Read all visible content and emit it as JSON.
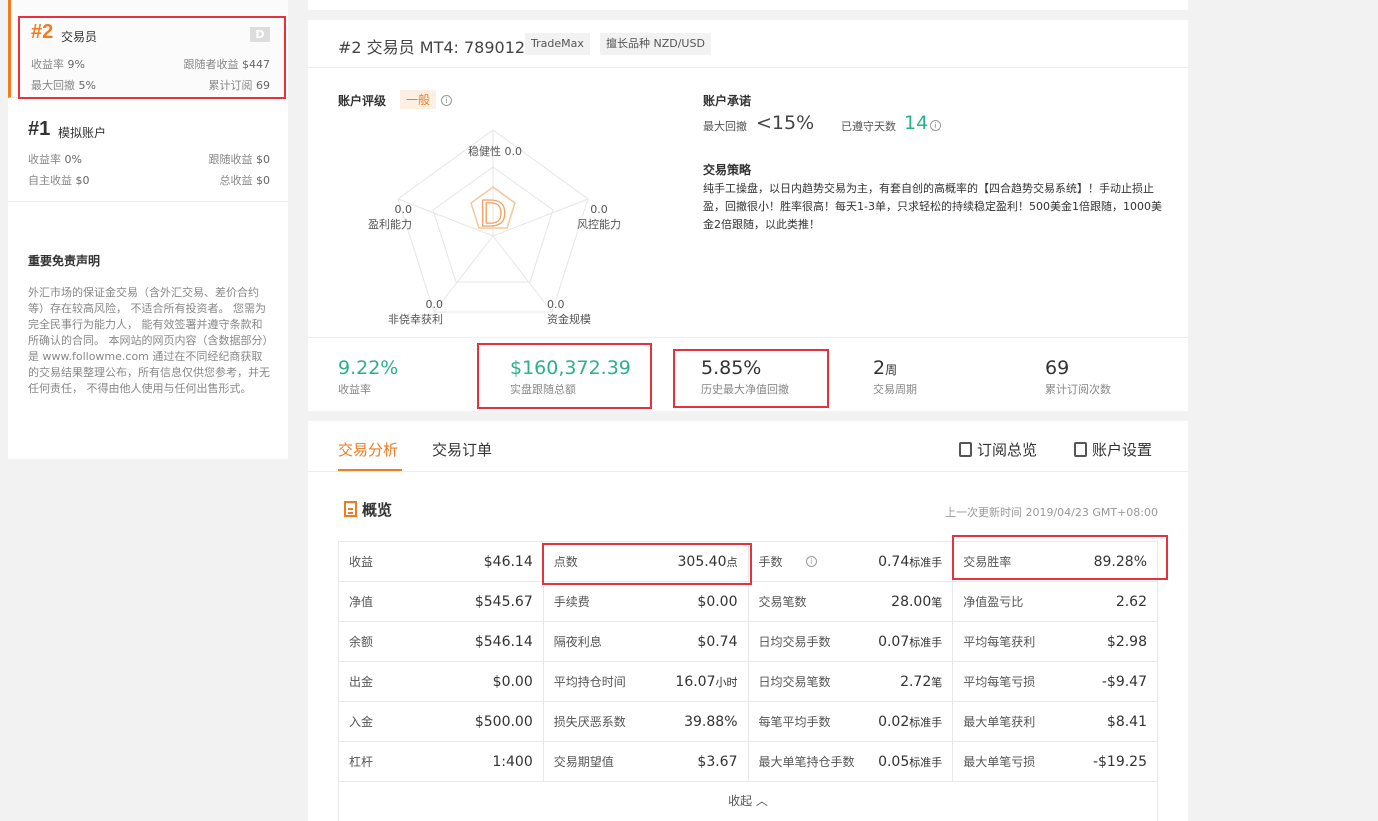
{
  "sidebar": {
    "accounts": [
      {
        "rank": "#2",
        "name": "交易员",
        "badge": "D",
        "row1_left_label": "收益率",
        "row1_left_value": "9%",
        "row1_right_label": "跟随者收益",
        "row1_right_value": "$447",
        "row2_left_label": "最大回撤",
        "row2_left_value": "5%",
        "row2_right_label": "累计订阅",
        "row2_right_value": "69"
      },
      {
        "rank": "#1",
        "name": "模拟账户",
        "row1_left_label": "收益率",
        "row1_left_value": "0%",
        "row1_right_label": "跟随收益",
        "row1_right_value": "$0",
        "row2_left_label": "自主收益",
        "row2_left_value": "$0",
        "row2_right_label": "总收益",
        "row2_right_value": "$0"
      }
    ],
    "disclaimer_title": "重要免责声明",
    "disclaimer_text": "外汇市场的保证金交易（含外汇交易、差价合约等）存在较高风险， 不适合所有投资者。 您需为完全民事行为能力人， 能有效签署并遵守条款和所确认的合同。 本网站的网页内容（含数据部分）是 www.followme.com 通过在不同经纪商获取的交易结果整理公布，所有信息仅供您参考，并无任何责任， 不得由他人使用与任何出售形式。"
  },
  "header": {
    "title": "#2 交易员  MT4: 789012",
    "broker": "TradeMax",
    "specialty": "擅长品种 NZD/USD"
  },
  "rating": {
    "label": "账户评级",
    "level": "一般",
    "grade": "D",
    "axes": [
      {
        "name": "稳健性",
        "value": "0.0"
      },
      {
        "name": "风控能力",
        "value": "0.0"
      },
      {
        "name": "资金规模",
        "value": "0.0"
      },
      {
        "name": "非侥幸获利",
        "value": "0.0"
      },
      {
        "name": "盈利能力",
        "value": "0.0"
      }
    ]
  },
  "promise": {
    "title": "账户承诺",
    "drawdown_label": "最大回撤",
    "drawdown_value": "<15%",
    "days_label": "已遵守天数",
    "days_value": "14"
  },
  "strategy": {
    "title": "交易策略",
    "text": "纯手工操盘，以日内趋势交易为主，有套自创的高概率的【四合趋势交易系统】！手动止损止盈，回撤很小！胜率很高！每天1-3单，只求轻松的持续稳定盈利！500美金1倍跟随，1000美金2倍跟随，以此类推！"
  },
  "stats": [
    {
      "value": "9.22%",
      "label": "收益率"
    },
    {
      "value": "$160,372.39",
      "label": "实盘跟随总额"
    },
    {
      "value": "5.85%",
      "label": "历史最大净值回撤"
    },
    {
      "value": "2",
      "unit": "周",
      "label": "交易周期"
    },
    {
      "value": "69",
      "label": "累计订阅次数"
    }
  ],
  "tabs": {
    "analysis": "交易分析",
    "orders": "交易订单",
    "subscribe_overview": "订阅总览",
    "account_settings": "账户设置"
  },
  "overview": {
    "title": "概览",
    "updated": "上一次更新时间 2019/04/23 GMT+08:00",
    "rows": [
      [
        [
          "收益",
          "$46.14",
          ""
        ],
        [
          "点数",
          "305.40",
          "点"
        ],
        [
          "手数",
          "0.74",
          "标准手"
        ],
        [
          "交易胜率",
          "89.28%",
          ""
        ]
      ],
      [
        [
          "净值",
          "$545.67",
          ""
        ],
        [
          "手续费",
          "$0.00",
          ""
        ],
        [
          "交易笔数",
          "28.00",
          "笔"
        ],
        [
          "净值盈亏比",
          "2.62",
          ""
        ]
      ],
      [
        [
          "余额",
          "$546.14",
          ""
        ],
        [
          "隔夜利息",
          "$0.74",
          ""
        ],
        [
          "日均交易手数",
          "0.07",
          "标准手"
        ],
        [
          "平均每笔获利",
          "$2.98",
          ""
        ]
      ],
      [
        [
          "出金",
          "$0.00",
          ""
        ],
        [
          "平均持仓时间",
          "16.07",
          "小时"
        ],
        [
          "日均交易笔数",
          "2.72",
          "笔"
        ],
        [
          "平均每笔亏损",
          "-$9.47",
          ""
        ]
      ],
      [
        [
          "入金",
          "$500.00",
          ""
        ],
        [
          "损失厌恶系数",
          "39.88%",
          ""
        ],
        [
          "每笔平均手数",
          "0.02",
          "标准手"
        ],
        [
          "最大单笔获利",
          "$8.41",
          ""
        ]
      ],
      [
        [
          "杠杆",
          "1:400",
          ""
        ],
        [
          "交易期望值",
          "$3.67",
          ""
        ],
        [
          "最大单笔持仓手数",
          "0.05",
          "标准手"
        ],
        [
          "最大单笔亏损",
          "-$19.25",
          ""
        ]
      ]
    ],
    "collapse": "收起"
  },
  "colors": {
    "accent": "#f07b20",
    "green": "#2bb08c",
    "highlight": "#e5323f"
  }
}
